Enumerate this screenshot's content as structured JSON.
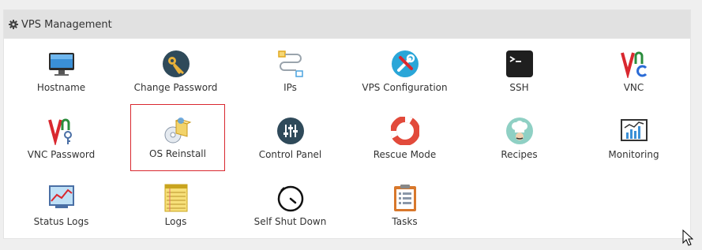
{
  "panel": {
    "title": "VPS Management",
    "header_icon": "gear-icon"
  },
  "tiles": [
    {
      "label": "Hostname",
      "icon": "monitor-icon"
    },
    {
      "label": "Change Password",
      "icon": "key-icon"
    },
    {
      "label": "IPs",
      "icon": "network-icon"
    },
    {
      "label": "VPS Configuration",
      "icon": "tools-icon"
    },
    {
      "label": "SSH",
      "icon": "terminal-icon"
    },
    {
      "label": "VNC",
      "icon": "vnc-icon"
    },
    {
      "label": "VNC Password",
      "icon": "vnc-key-icon"
    },
    {
      "label": "OS Reinstall",
      "icon": "os-install-icon"
    },
    {
      "label": "Control Panel",
      "icon": "sliders-icon"
    },
    {
      "label": "Rescue Mode",
      "icon": "lifebuoy-icon"
    },
    {
      "label": "Recipes",
      "icon": "chef-icon"
    },
    {
      "label": "Monitoring",
      "icon": "monitoring-chart-icon"
    },
    {
      "label": "Status Logs",
      "icon": "status-chart-icon"
    },
    {
      "label": "Logs",
      "icon": "notepad-icon"
    },
    {
      "label": "Self Shut Down",
      "icon": "timer-icon"
    },
    {
      "label": "Tasks",
      "icon": "clipboard-icon"
    }
  ],
  "selected_tile": "OS Reinstall",
  "colors": {
    "header_bg": "#e1e1e1",
    "page_bg": "#efefef",
    "selected_border": "#d9282f"
  }
}
